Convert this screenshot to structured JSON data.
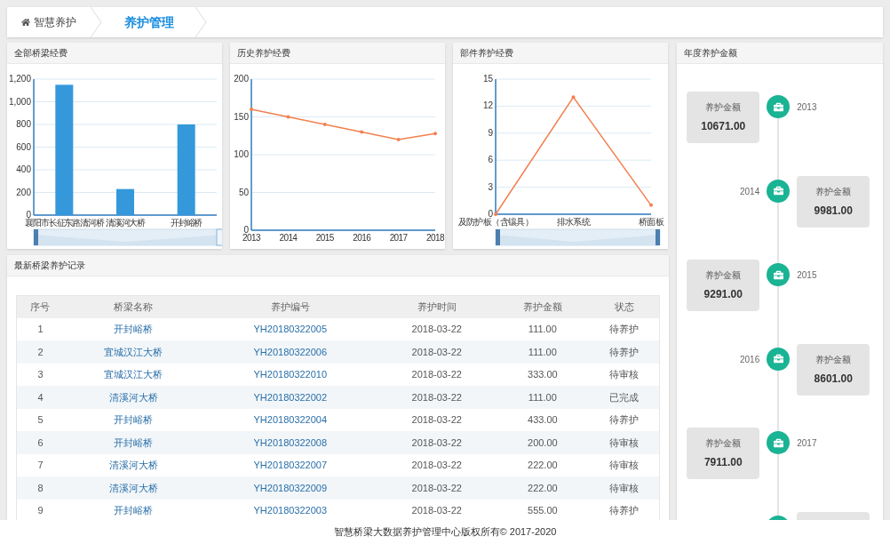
{
  "breadcrumb": [
    {
      "label": "智慧养护",
      "selected": false
    },
    {
      "label": "养护管理",
      "selected": true
    }
  ],
  "charts": [
    {
      "title": "全部桥梁经费",
      "chart_data": {
        "type": "bar",
        "categories": [
          "襄阳市长征东路清河桥",
          "清溪河大桥",
          "开封峪桥"
        ],
        "grid": true,
        "series": [
          {
            "color": "#3498db",
            "values": [
              1150,
              230,
              800
            ]
          }
        ],
        "ylim": [
          0,
          1200
        ],
        "yticks": [
          {
            "value": 0,
            "label": "0"
          },
          {
            "value": 200,
            "label": "200"
          },
          {
            "value": 400,
            "label": "400"
          },
          {
            "value": 600,
            "label": "600"
          },
          {
            "value": 800,
            "label": "800"
          },
          {
            "value": 1000,
            "label": "1,000"
          },
          {
            "value": 1200,
            "label": "1,200"
          }
        ]
      },
      "zoom_slider": true
    },
    {
      "title": "历史养护经费",
      "chart_data": {
        "type": "line",
        "categories": [
          "2013",
          "2014",
          "2015",
          "2016",
          "2017",
          "2018"
        ],
        "grid": true,
        "series": [
          {
            "color": "#f3804f",
            "values": [
              160,
              150,
              140,
              130,
              120,
              128
            ]
          }
        ],
        "ylim": [
          0,
          200
        ],
        "yticks": [
          0,
          50,
          100,
          150,
          200
        ]
      },
      "zoom_slider": false
    },
    {
      "title": "部件养护经费",
      "chart_data": {
        "type": "line",
        "categories": [
          "及防护板（含镶具）",
          "排水系统",
          "桥面板"
        ],
        "grid": true,
        "series": [
          {
            "color": "#f3804f",
            "values": [
              0,
              13,
              1
            ]
          }
        ],
        "ylim": [
          0,
          15
        ],
        "yticks": [
          0,
          3,
          6,
          9,
          12,
          15
        ]
      },
      "zoom_slider": true
    }
  ],
  "records": {
    "title": "最新桥梁养护记录",
    "columns": [
      "序号",
      "桥梁名称",
      "养护编号",
      "养护时间",
      "养护金额",
      "状态"
    ],
    "rows": [
      [
        "1",
        "开封峪桥",
        "YH20180322005",
        "2018-03-22",
        "111.00",
        "待养护"
      ],
      [
        "2",
        "宜城汉江大桥",
        "YH20180322006",
        "2018-03-22",
        "111.00",
        "待养护"
      ],
      [
        "3",
        "宜城汉江大桥",
        "YH20180322010",
        "2018-03-22",
        "333.00",
        "待审核"
      ],
      [
        "4",
        "清溪河大桥",
        "YH20180322002",
        "2018-03-22",
        "111.00",
        "已完成"
      ],
      [
        "5",
        "开封峪桥",
        "YH20180322004",
        "2018-03-22",
        "433.00",
        "待养护"
      ],
      [
        "6",
        "开封峪桥",
        "YH20180322008",
        "2018-03-22",
        "200.00",
        "待审核"
      ],
      [
        "7",
        "清溪河大桥",
        "YH20180322007",
        "2018-03-22",
        "222.00",
        "待审核"
      ],
      [
        "8",
        "清溪河大桥",
        "YH20180322009",
        "2018-03-22",
        "222.00",
        "待审核"
      ],
      [
        "9",
        "开封峪桥",
        "YH20180322003",
        "2018-03-22",
        "555.00",
        "待养护"
      ]
    ]
  },
  "timeline": {
    "title": "年度养护金额",
    "items": [
      {
        "kind": "entry",
        "year": "2013",
        "label": "养护金额",
        "amount": "10671.00"
      },
      {
        "kind": "entry",
        "year": "2014",
        "label": "养护金额",
        "amount": "9981.00"
      },
      {
        "kind": "entry",
        "year": "2015",
        "label": "养护金额",
        "amount": "9291.00"
      },
      {
        "kind": "entry",
        "year": "2016",
        "label": "养护金额",
        "amount": "8601.00"
      },
      {
        "kind": "entry",
        "year": "2017",
        "label": "养护金额",
        "amount": "7911.00"
      },
      {
        "kind": "cut"
      }
    ]
  },
  "footer": "智慧桥梁大数据养护管理中心版权所有© 2017-2020"
}
